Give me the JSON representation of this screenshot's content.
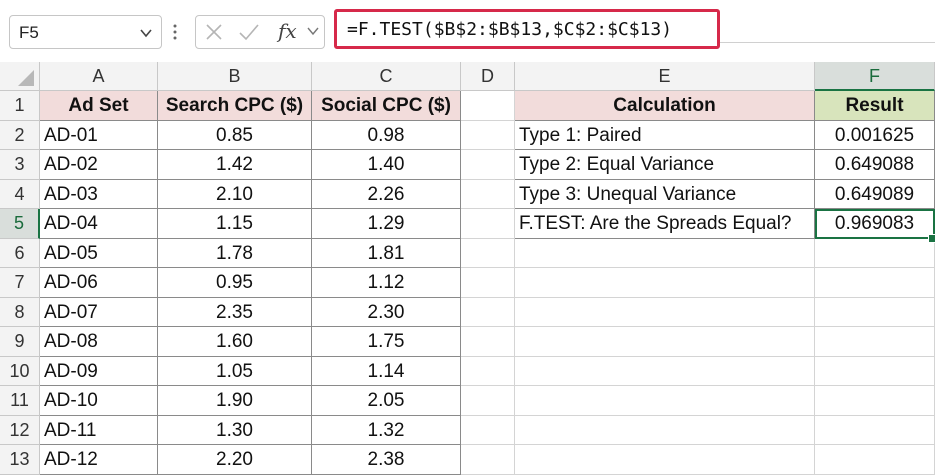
{
  "name_box": {
    "value": "F5"
  },
  "formula_bar": {
    "cancel_icon": "close-icon",
    "enter_icon": "check-icon",
    "fx_label": "fx",
    "formula": "=F.TEST($B$2:$B$13,$C$2:$C$13)"
  },
  "columns": [
    "A",
    "B",
    "C",
    "D",
    "E",
    "F"
  ],
  "rows": [
    "1",
    "2",
    "3",
    "4",
    "5",
    "6",
    "7",
    "8",
    "9",
    "10",
    "11",
    "12",
    "13"
  ],
  "table": {
    "headers": [
      "Ad Set",
      "Search CPC ($)",
      "Social CPC ($)"
    ],
    "data": [
      [
        "AD-01",
        "0.85",
        "0.98"
      ],
      [
        "AD-02",
        "1.42",
        "1.40"
      ],
      [
        "AD-03",
        "2.10",
        "2.26"
      ],
      [
        "AD-04",
        "1.15",
        "1.29"
      ],
      [
        "AD-05",
        "1.78",
        "1.81"
      ],
      [
        "AD-06",
        "0.95",
        "1.12"
      ],
      [
        "AD-07",
        "2.35",
        "2.30"
      ],
      [
        "AD-08",
        "1.60",
        "1.75"
      ],
      [
        "AD-09",
        "1.05",
        "1.14"
      ],
      [
        "AD-10",
        "1.90",
        "2.05"
      ],
      [
        "AD-11",
        "1.30",
        "1.32"
      ],
      [
        "AD-12",
        "2.20",
        "2.38"
      ]
    ]
  },
  "results": {
    "headers": [
      "Calculation",
      "Result"
    ],
    "data": [
      [
        "Type 1: Paired",
        "0.001625"
      ],
      [
        "Type 2: Equal Variance",
        "0.649088"
      ],
      [
        "Type 3: Unequal Variance",
        "0.649089"
      ],
      [
        "F.TEST: Are the Spreads Equal?",
        "0.969083"
      ]
    ]
  },
  "colors": {
    "header_pink": "#f2dcdb",
    "header_green": "#d8e4bc",
    "selection_green": "#1a7343",
    "formula_highlight": "#d6294a"
  }
}
